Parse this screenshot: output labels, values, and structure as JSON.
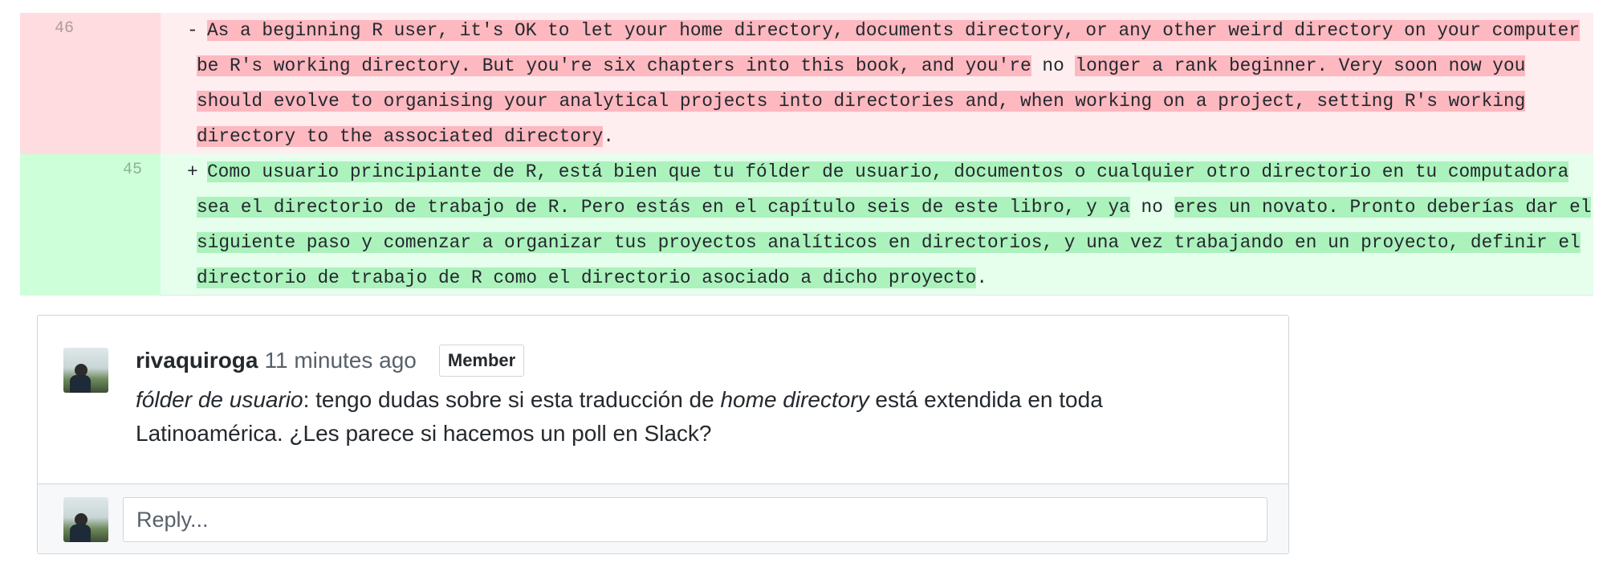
{
  "diff": {
    "deleted_line": {
      "number": "46",
      "sign": "-",
      "segments": [
        {
          "text": "As a beginning R user, it's OK to let your home directory, documents directory, or any other weird directory on your computer be R's working directory. But you're six chapters into this book, and you're",
          "highlight": true
        },
        {
          "text": " no ",
          "highlight": false
        },
        {
          "text": "longer a rank beginner. Very soon now you should evolve to organising your analytical projects into directories and, when working on a project, setting R's working directory to the associated directory",
          "highlight": true
        },
        {
          "text": ".",
          "highlight": false
        }
      ]
    },
    "added_line": {
      "number": "45",
      "sign": "+",
      "segments": [
        {
          "text": "Como usuario principiante de R, está bien que tu fólder de usuario, documentos o cualquier otro directorio en tu computadora sea el directorio de trabajo de R. Pero estás en el capítulo seis de este libro, y ya",
          "highlight": true
        },
        {
          "text": " no ",
          "highlight": false
        },
        {
          "text": "eres un novato. Pronto deberías dar el siguiente paso y comenzar a organizar tus proyectos analíticos en directorios, y una vez trabajando en un proyecto, definir el directorio de trabajo de R como el directorio asociado a dicho proyecto",
          "highlight": true
        },
        {
          "text": ".",
          "highlight": false
        }
      ]
    }
  },
  "comment": {
    "author": "rivaquiroga",
    "time": "11 minutes ago",
    "badge": "Member",
    "body": {
      "italic_1": "fólder de usuario",
      "text_1": ": tengo dudas sobre si esta traducción de ",
      "italic_2": "home directory",
      "text_2": " está extendida en toda Latinoamérica. ¿Les parece si hacemos un poll en Slack?"
    }
  },
  "reply": {
    "placeholder": "Reply..."
  },
  "colors": {
    "deleted_bg": "#ffeef0",
    "deleted_highlight": "#fdb8c0",
    "added_bg": "#e6ffed",
    "added_highlight": "#acf2bd"
  }
}
